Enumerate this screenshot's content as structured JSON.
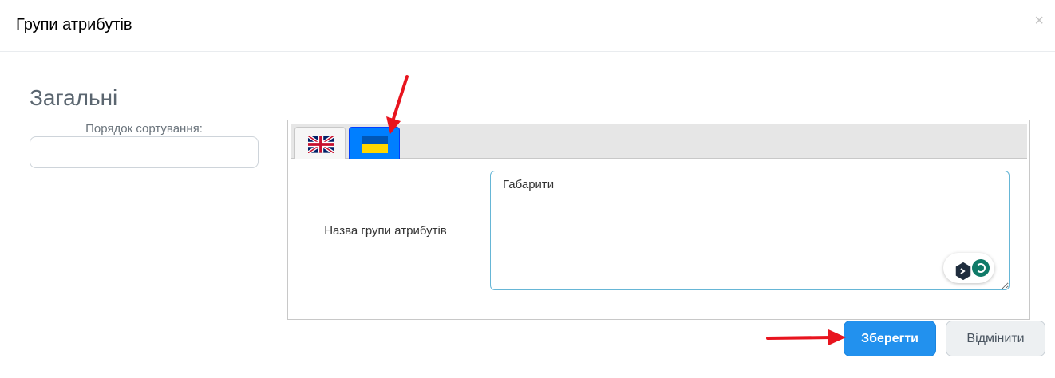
{
  "dialog": {
    "title": "Групи атрибутів",
    "close_label": "×"
  },
  "general": {
    "section_title": "Загальні",
    "sort_order_label": "Порядок сортування:",
    "sort_order_value": ""
  },
  "languages": {
    "tabs": [
      {
        "code": "en",
        "flag": "uk-flag-icon",
        "active": false
      },
      {
        "code": "uk",
        "flag": "ukraine-flag-icon",
        "active": true
      }
    ],
    "field_label": "Назва групи атрибутів",
    "field_value": "Габарити"
  },
  "footer": {
    "save_label": "Зберегти",
    "cancel_label": "Відмінити"
  },
  "colors": {
    "primary": "#2291ee",
    "active_tab": "#007fff",
    "annotation_arrow": "#e8141e",
    "flag_blue": "#0057b7",
    "flag_yellow": "#ffd700"
  }
}
